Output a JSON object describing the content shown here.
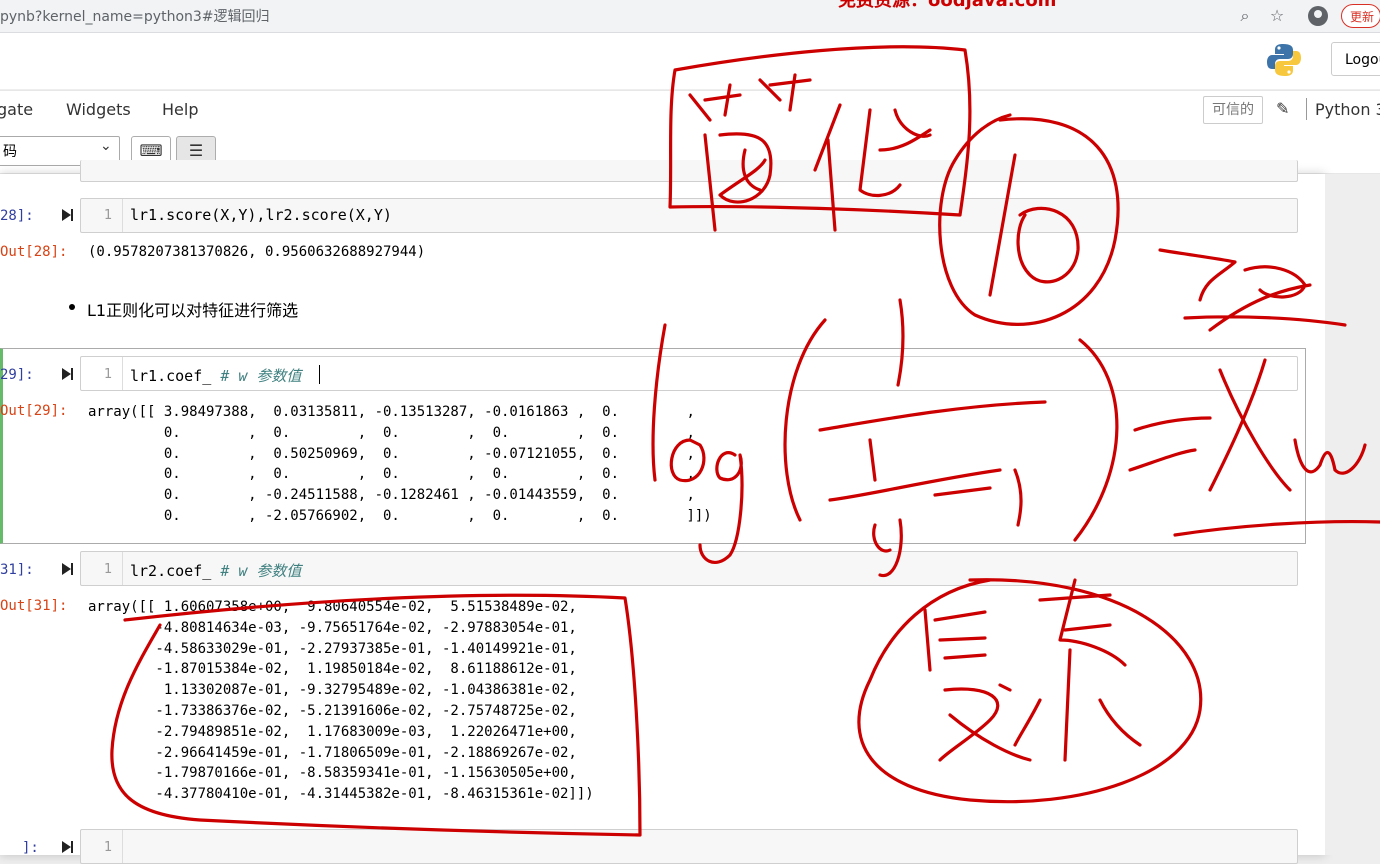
{
  "browser": {
    "url": "pynb?kernel_name=python3#逻辑回归",
    "update_label": "更新",
    "top_overlay_text": "免费资源：oodjava.com"
  },
  "header": {
    "logout_label": "Logout"
  },
  "menubar": {
    "items": [
      "gate",
      "Widgets",
      "Help"
    ],
    "trusted_label": "可信的",
    "kernel_name": "Python 3"
  },
  "toolbar": {
    "cell_type": "码"
  },
  "cells": {
    "prev_input_visible": true,
    "c28": {
      "in_prompt": "28]:",
      "line_no": "1",
      "code": "lr1.score(X,Y),lr2.score(X,Y)",
      "out_prompt": "Out[28]:",
      "output": "(0.9578207381370826, 0.9560632688927944)"
    },
    "md": {
      "bullet_text": "L1正则化可以对特征进行筛选"
    },
    "c29": {
      "in_prompt": "29]:",
      "line_no": "1",
      "code": "lr1.coef_ ",
      "comment": "# w 参数值",
      "out_prompt": "Out[29]:",
      "output": "array([[ 3.98497388,  0.03135811, -0.13513287, -0.0161863 ,  0.        ,\n         0.        ,  0.        ,  0.        ,  0.        ,  0.        ,\n         0.        ,  0.50250969,  0.        , -0.07121055,  0.        ,\n         0.        ,  0.        ,  0.        ,  0.        ,  0.        ,\n         0.        , -0.24511588, -0.1282461 , -0.01443559,  0.        ,\n         0.        , -2.05766902,  0.        ,  0.        ,  0.        ]])"
    },
    "c31": {
      "in_prompt": "31]:",
      "line_no": "1",
      "code": "lr2.coef_ ",
      "comment": "# w 参数值",
      "out_prompt": "Out[31]:",
      "output": "array([[ 1.60607358e+00,  9.80640554e-02,  5.51538489e-02,\n        -4.80814634e-03, -9.75651764e-02, -2.97883054e-01,\n        -4.58633029e-01, -2.27937385e-01, -1.40149921e-01,\n        -1.87015384e-02,  1.19850184e-02,  8.61188612e-01,\n         1.13302087e-01, -9.32795489e-02, -1.04386381e-02,\n        -1.73386376e-02, -5.21391606e-02, -2.75748725e-02,\n        -2.79489851e-02,  1.17683009e-03,  1.22026471e+00,\n        -2.96641459e-01, -1.71806509e-01, -2.18869267e-02,\n        -1.79870166e-01, -8.58359341e-01, -1.15630505e+00,\n        -4.37780410e-01, -4.31445382e-01, -8.46315361e-02]])"
    },
    "c_next": {
      "in_prompt": "]:",
      "line_no": "1"
    }
  },
  "colors": {
    "ink": "#cc0000",
    "in_prompt": "#303f9f",
    "out_prompt": "#d84315",
    "selected_cell_bar": "#66bb6a"
  },
  "icons": [
    "search-zoom-icon",
    "star-icon",
    "profile-icon",
    "python-logo",
    "pencil-icon",
    "keyboard-icon",
    "command-palette-icon",
    "run-cell-icon"
  ]
}
